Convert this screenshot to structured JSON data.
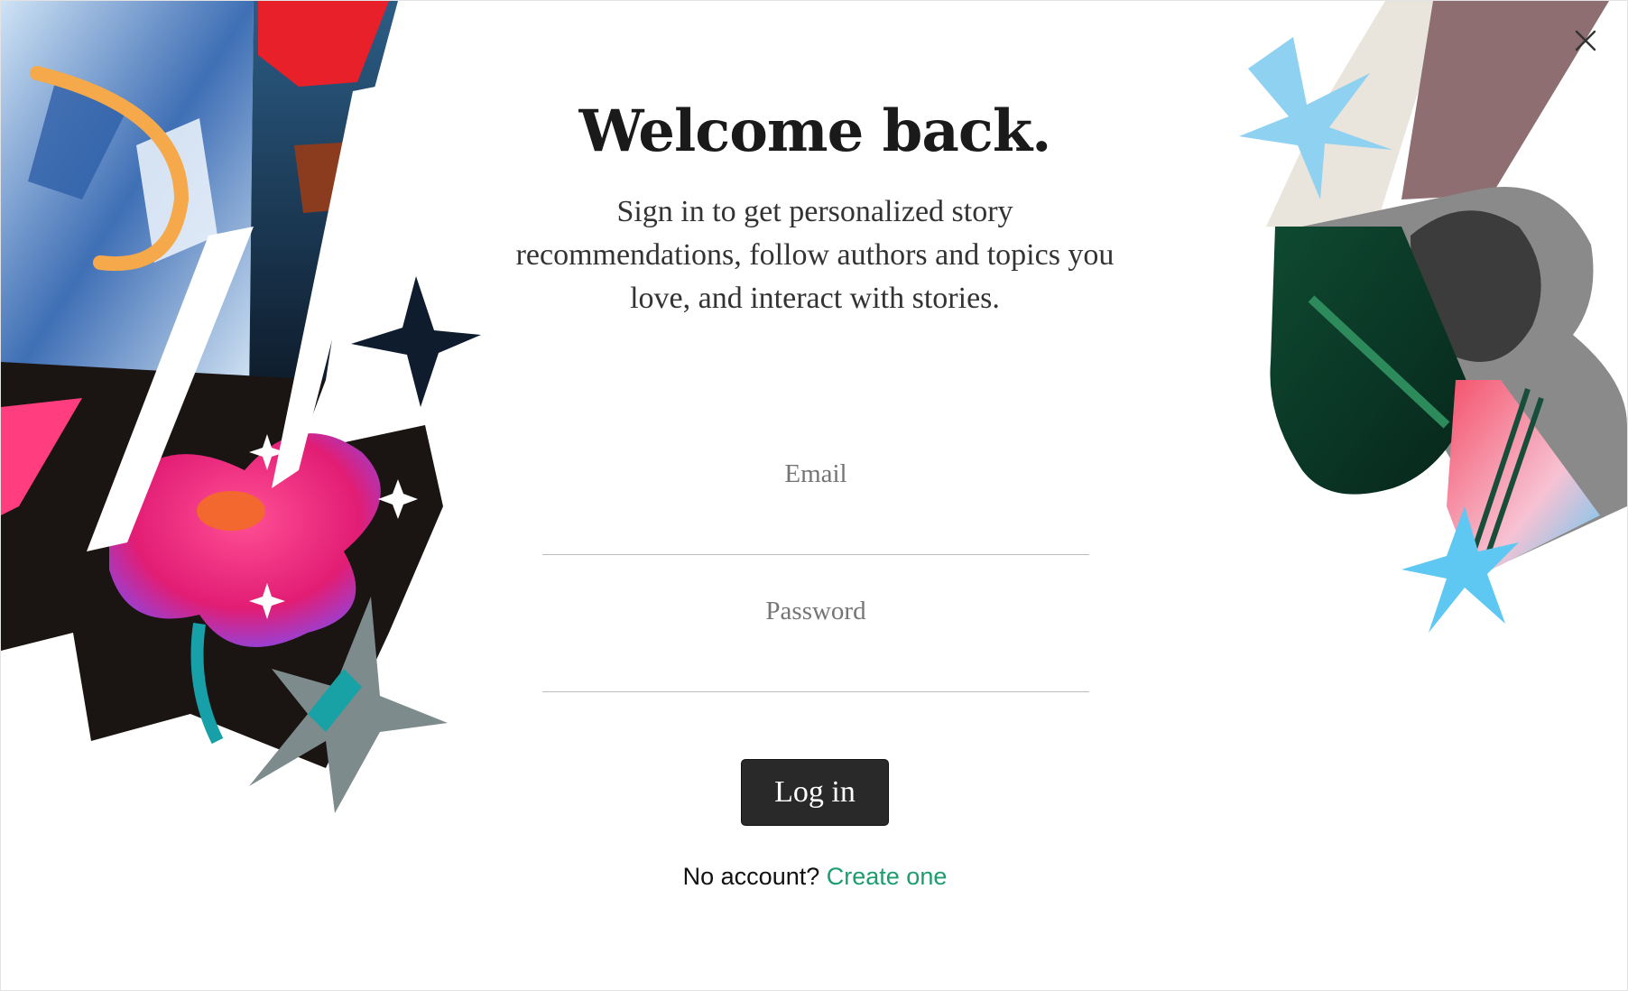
{
  "dialog": {
    "title": "Welcome back.",
    "subtitle": "Sign in to get personalized story recommendations, follow authors and topics you love, and interact with stories."
  },
  "form": {
    "email_label": "Email",
    "email_value": "",
    "password_label": "Password",
    "password_value": "",
    "login_label": "Log in"
  },
  "footer": {
    "prompt": "No account?",
    "link": "Create one"
  },
  "icons": {
    "close": "close-icon"
  },
  "colors": {
    "button_bg": "#292929",
    "link": "#1c9d6e",
    "title": "#1a1a1a"
  }
}
